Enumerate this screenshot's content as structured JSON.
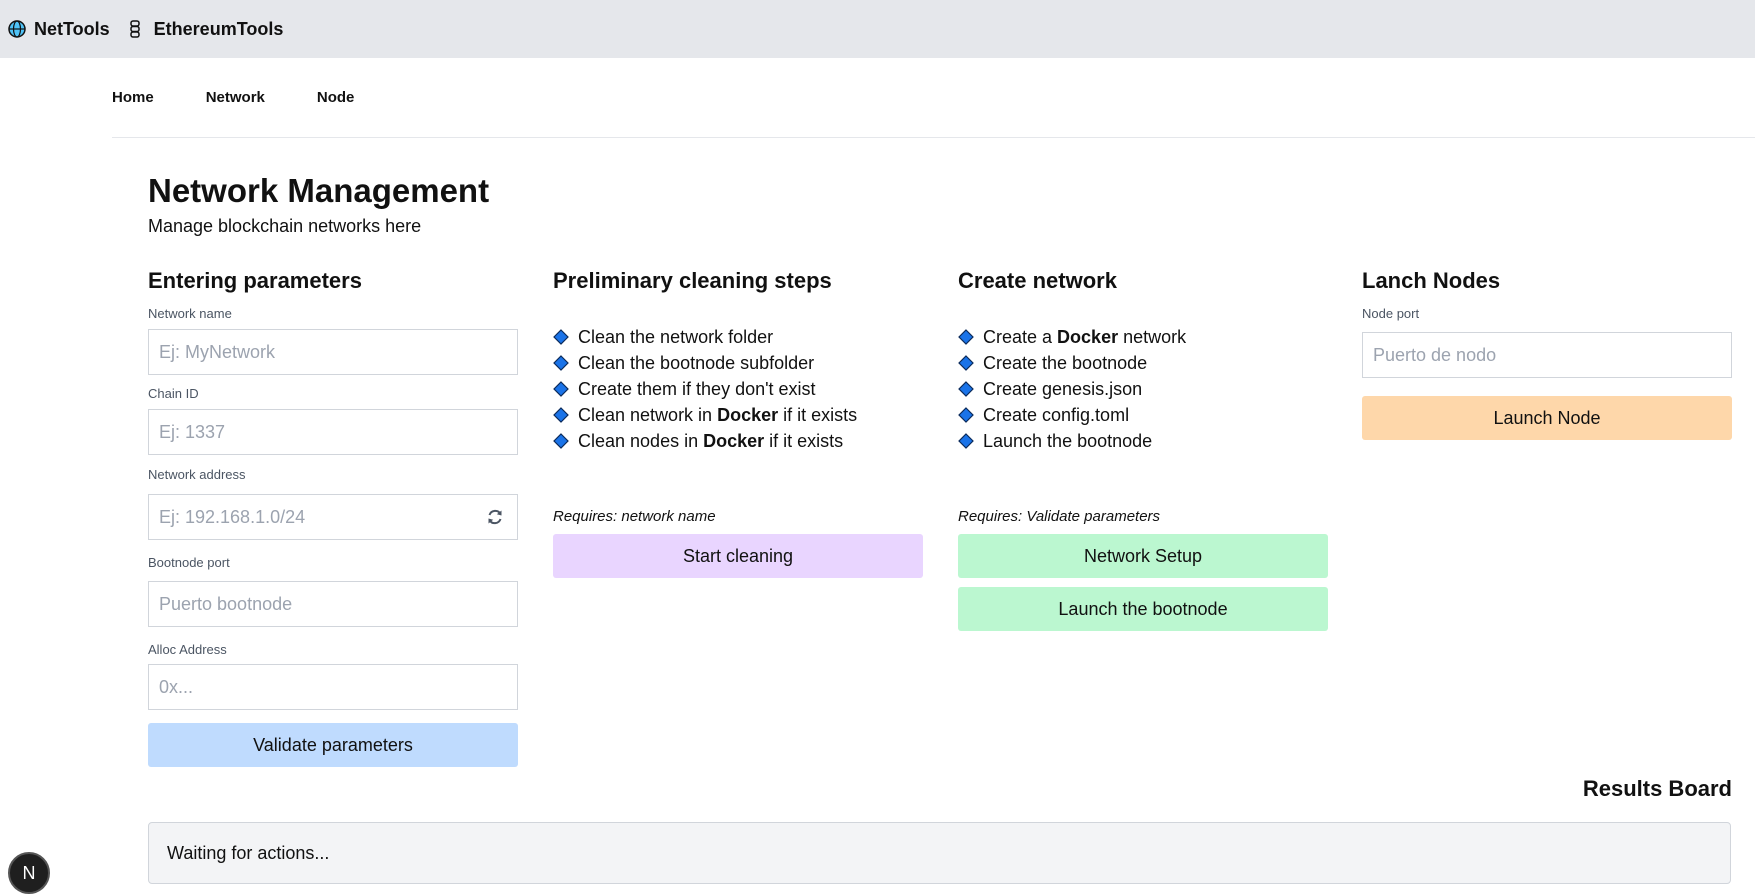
{
  "topbar": {
    "brands": [
      {
        "label": "NetTools",
        "icon": "globe-icon"
      },
      {
        "label": "EthereumTools",
        "icon": "chain-icon"
      }
    ]
  },
  "nav": {
    "items": [
      "Home",
      "Network",
      "Node"
    ]
  },
  "header": {
    "title": "Network Management",
    "subtitle": "Manage blockchain networks here"
  },
  "params": {
    "title": "Entering parameters",
    "network_name": {
      "label": "Network name",
      "placeholder": "Ej: MyNetwork"
    },
    "chain_id": {
      "label": "Chain ID",
      "placeholder": "Ej: 1337"
    },
    "network_address": {
      "label": "Network address",
      "placeholder": "Ej: 192.168.1.0/24"
    },
    "bootnode_port": {
      "label": "Bootnode port",
      "placeholder": "Puerto bootnode"
    },
    "alloc_address": {
      "label": "Alloc Address",
      "placeholder": "0x..."
    },
    "validate_button": "Validate parameters",
    "button_color": "#bfdbfe"
  },
  "cleaning": {
    "title": "Preliminary cleaning steps",
    "steps": [
      {
        "before": "Clean the network folder",
        "bold": "",
        "after": ""
      },
      {
        "before": "Clean the bootnode subfolder",
        "bold": "",
        "after": ""
      },
      {
        "before": "Create them if they don't exist",
        "bold": "",
        "after": ""
      },
      {
        "before": "Clean network in ",
        "bold": "Docker",
        "after": " if it exists"
      },
      {
        "before": "Clean nodes in ",
        "bold": "Docker",
        "after": " if it exists"
      }
    ],
    "requires": "Requires: network name",
    "button": "Start cleaning",
    "button_color": "#e9d5ff"
  },
  "create": {
    "title": "Create network",
    "steps": [
      {
        "before": "Create a ",
        "bold": "Docker",
        "after": " network"
      },
      {
        "before": "Create the bootnode",
        "bold": "",
        "after": ""
      },
      {
        "before": "Create genesis.json",
        "bold": "",
        "after": ""
      },
      {
        "before": "Create config.toml",
        "bold": "",
        "after": ""
      },
      {
        "before": "Launch the bootnode",
        "bold": "",
        "after": ""
      }
    ],
    "requires": "Requires: Validate parameters",
    "setup_button": "Network Setup",
    "launch_button": "Launch the bootnode",
    "button_color": "#bbf7d0"
  },
  "nodes": {
    "title": "Lanch Nodes",
    "node_port": {
      "label": "Node port",
      "placeholder": "Puerto de nodo"
    },
    "launch_button": "Launch Node",
    "button_color": "#fed7aa"
  },
  "results": {
    "title": "Results Board",
    "text": "Waiting for actions..."
  },
  "badge": {
    "letter": "N"
  },
  "colors": {
    "diamond": "#1a73e8",
    "topbar": "#e5e7eb"
  }
}
